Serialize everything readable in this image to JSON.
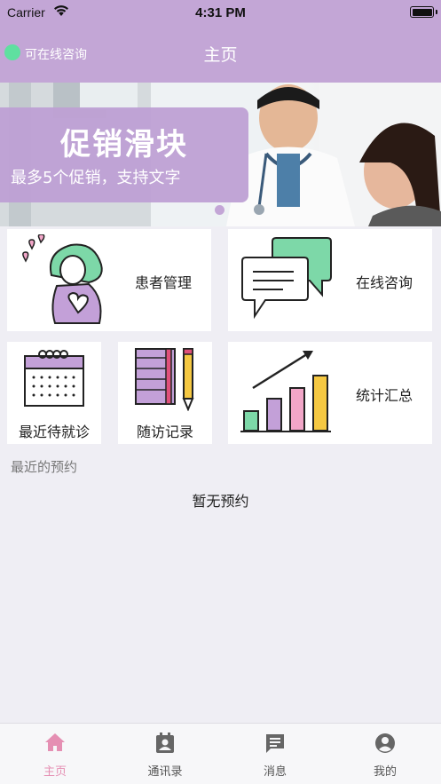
{
  "status_bar": {
    "carrier": "Carrier",
    "time": "4:31 PM"
  },
  "header": {
    "online_label": "可在线咨询",
    "title": "主页"
  },
  "banner": {
    "title": "促销滑块",
    "subtitle": "最多5个促销，支持文字"
  },
  "cards": {
    "patient_management": "患者管理",
    "online_consult": "在线咨询",
    "recent_visits": "最近待就诊",
    "follow_up_records": "随访记录",
    "statistics": "统计汇总"
  },
  "appointments": {
    "section_title": "最近的预约",
    "empty_text": "暂无预约"
  },
  "tabs": [
    {
      "label": "主页",
      "icon": "home-icon"
    },
    {
      "label": "通讯录",
      "icon": "contacts-icon"
    },
    {
      "label": "消息",
      "icon": "message-icon"
    },
    {
      "label": "我的",
      "icon": "profile-icon"
    }
  ],
  "colors": {
    "header": "#c3a6d6",
    "accent": "#e58fb3",
    "online": "#5fe0a0",
    "background": "#efeef4"
  }
}
